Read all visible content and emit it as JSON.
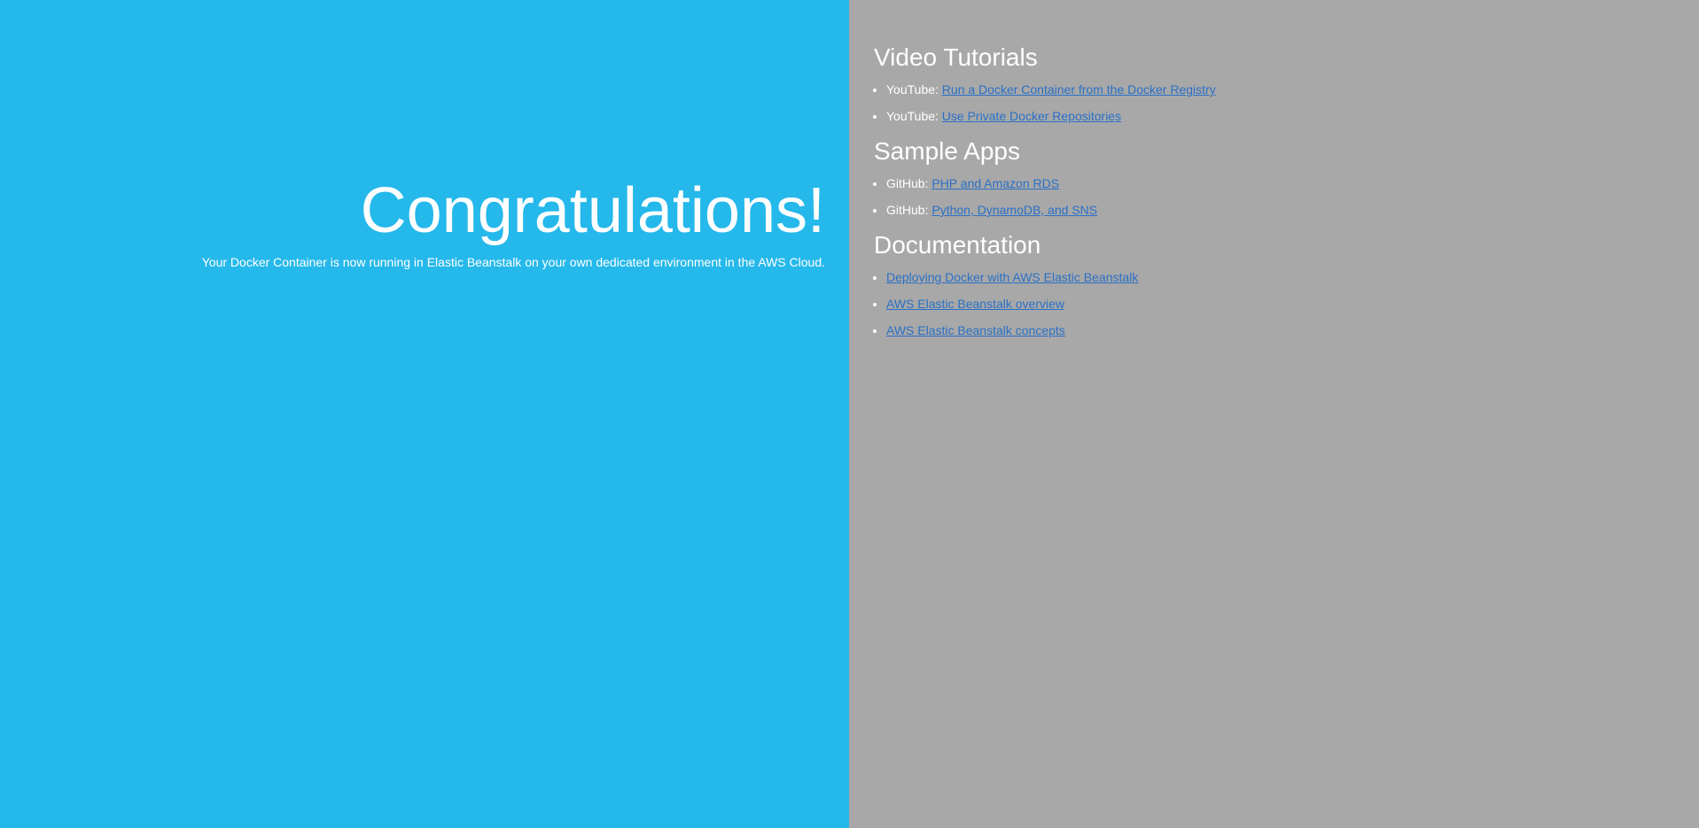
{
  "colors": {
    "left_bg": "#25b8eb",
    "right_bg": "#a8a8a8",
    "link": "#2a70c6",
    "text": "#ffffff"
  },
  "hero": {
    "title": "Congratulations!",
    "message": "Your Docker Container is now running in Elastic Beanstalk on your own dedicated environment in the AWS Cloud."
  },
  "sections": [
    {
      "heading": "Video Tutorials",
      "items": [
        {
          "prefix": "YouTube: ",
          "link": "Run a Docker Container from the Docker Registry"
        },
        {
          "prefix": "YouTube: ",
          "link": "Use Private Docker Repositories"
        }
      ]
    },
    {
      "heading": "Sample Apps",
      "items": [
        {
          "prefix": "GitHub: ",
          "link": "PHP and Amazon RDS"
        },
        {
          "prefix": "GitHub: ",
          "link": "Python, DynamoDB, and SNS"
        }
      ]
    },
    {
      "heading": "Documentation",
      "items": [
        {
          "prefix": "",
          "link": "Deploying Docker with AWS Elastic Beanstalk"
        },
        {
          "prefix": "",
          "link": "AWS Elastic Beanstalk overview"
        },
        {
          "prefix": "",
          "link": "AWS Elastic Beanstalk concepts"
        }
      ]
    }
  ]
}
